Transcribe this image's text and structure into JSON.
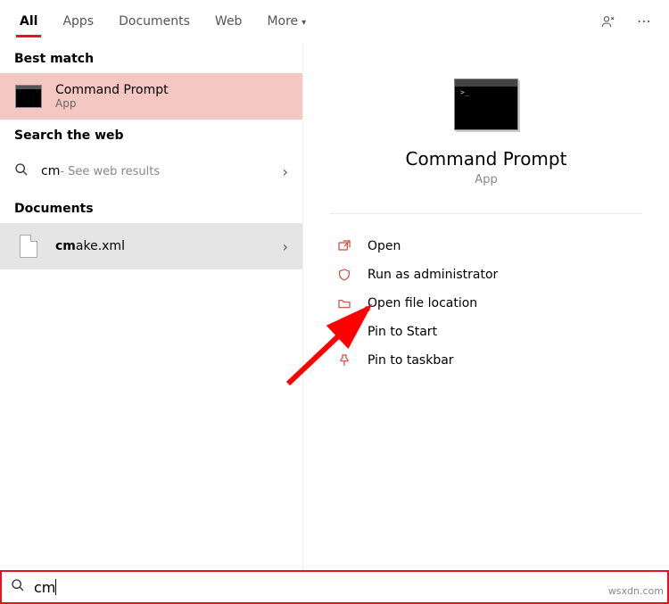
{
  "tabs": {
    "all": "All",
    "apps": "Apps",
    "documents": "Documents",
    "web": "Web",
    "more": "More"
  },
  "left": {
    "best_match_header": "Best match",
    "best_match": {
      "title": "Command Prompt",
      "subtitle": "App"
    },
    "web_header": "Search the web",
    "web": {
      "query": "cm",
      "hint": " - See web results"
    },
    "docs_header": "Documents",
    "doc": {
      "prefix": "cm",
      "rest": "ake.xml"
    }
  },
  "preview": {
    "title": "Command Prompt",
    "subtitle": "App"
  },
  "actions": {
    "open": "Open",
    "run_admin": "Run as administrator",
    "open_location": "Open file location",
    "pin_start": "Pin to Start",
    "pin_taskbar": "Pin to taskbar"
  },
  "search": {
    "value": "cm",
    "placeholder": ""
  },
  "watermark": "wsxdn.com"
}
